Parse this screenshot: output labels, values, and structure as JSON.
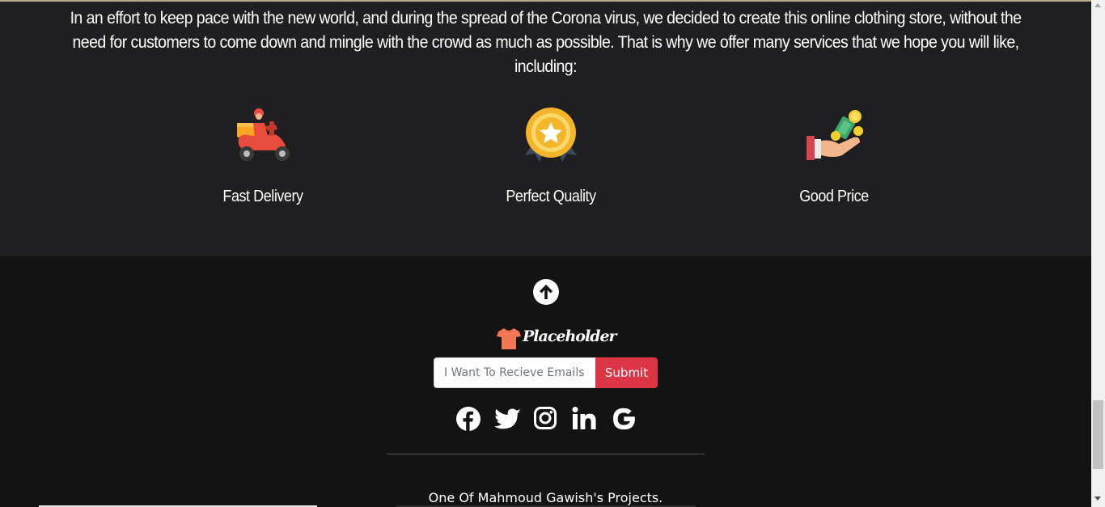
{
  "about": {
    "text": "In an effort to keep pace with the new world, and during the spread of the Corona virus, we decided to create this online clothing store, without the need for customers to come down and mingle with the crowd as much as possible. That is why we offer many services that we hope you will like, including:"
  },
  "features": [
    {
      "label": "Fast Delivery",
      "icon": "delivery-scooter-icon"
    },
    {
      "label": "Perfect Quality",
      "icon": "quality-medal-icon"
    },
    {
      "label": "Good Price",
      "icon": "money-hand-icon"
    }
  ],
  "footer": {
    "back_to_top_icon": "arrow-up-circle-icon",
    "logo_text": "Placeholder",
    "logo_icon": "shirt-icon",
    "newsletter": {
      "placeholder": "I Want To Recieve Emails",
      "value": "",
      "submit_label": "Submit"
    },
    "socials": [
      "facebook-icon",
      "twitter-icon",
      "instagram-icon",
      "linkedin-icon",
      "google-icon"
    ],
    "credit": "One Of Mahmoud Gawish's Projects."
  },
  "colors": {
    "section_bg": "#1f1f22",
    "footer_bg": "#131314",
    "submit_red": "#dc3545",
    "text": "#ffffff"
  }
}
